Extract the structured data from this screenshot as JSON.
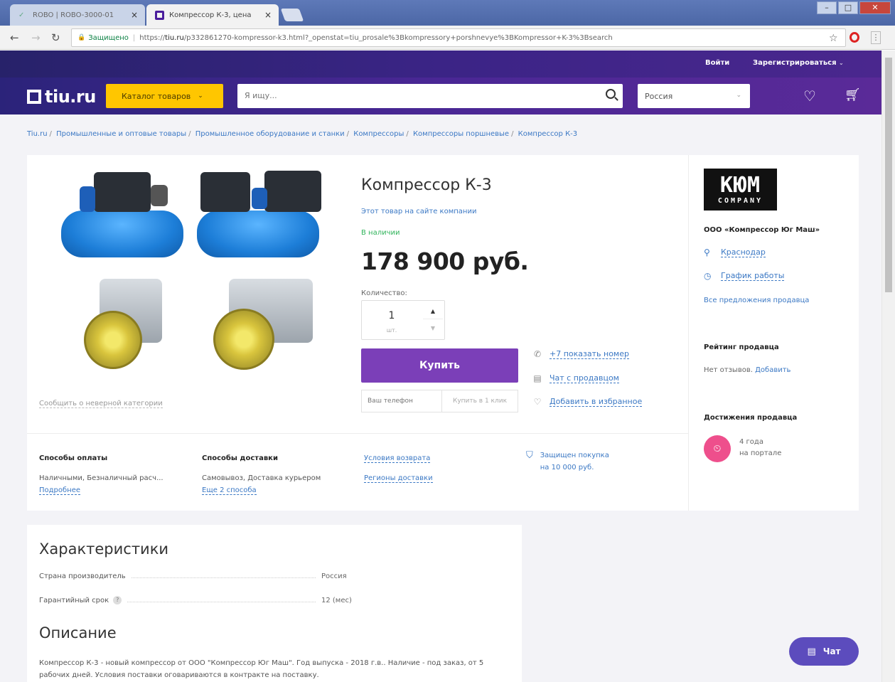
{
  "browser": {
    "tabs": [
      {
        "label": "ROBO | ROBO-3000-01",
        "close": "×"
      },
      {
        "label": "Компрессор К-3, цена",
        "close": "×"
      }
    ],
    "secure_label": "Защищено",
    "url_prefix": "https://",
    "url_host": "tiu.ru",
    "url_rest": "/p332861270-kompressor-k3.html?_openstat=tiu_prosale%3Bkompressory+porshnevye%3BKompressor+K-3%3Bsearch"
  },
  "header": {
    "login": "Войти",
    "register": "Зарегистрироваться",
    "logo": "tiu.ru",
    "catalog": "Каталог товаров",
    "search_placeholder": "Я ищу...",
    "region": "Россия"
  },
  "breadcrumb": [
    "Tiu.ru",
    "Промышленные и оптовые товары",
    "Промышленное оборудование и станки",
    "Компрессоры",
    "Компрессоры поршневые",
    "Компрессор К-3"
  ],
  "product": {
    "title": "Компрессор К-3",
    "company_link": "Этот товар на сайте компании",
    "stock": "В наличии",
    "price": "178 900 руб.",
    "qty_label": "Количество:",
    "qty": "1",
    "qty_unit": "шт.",
    "buy": "Купить",
    "phone_placeholder": "Ваш телефон",
    "one_click": "Купить в 1 клик",
    "show_phone": "+7 показать номер",
    "chat_seller": "Чат с продавцом",
    "add_fav": "Добавить в избранное",
    "report": "Сообщить о неверной категории"
  },
  "seller": {
    "logo_big": "КЮМ",
    "logo_small": "COMPANY",
    "name": "ООО «Компрессор Юг Маш»",
    "city": "Краснодар",
    "schedule": "График работы",
    "all_offers": "Все предложения продавца",
    "rating_title": "Рейтинг продавца",
    "no_reviews": "Нет отзывов.",
    "add_review": "Добавить",
    "achv_title": "Достижения продавца",
    "achv_line1": "4 года",
    "achv_line2": "на портале"
  },
  "info": {
    "payment_title": "Способы оплаты",
    "payment_text": "Наличными, Безналичный расч...",
    "payment_more": "Подробнее",
    "delivery_title": "Способы доставки",
    "delivery_text": "Самовывоз, Доставка курьером",
    "delivery_more": "Еще 2 способа",
    "return_link": "Условия возврата",
    "regions_link": "Регионы доставки",
    "protect_line1": "Защищен покупка",
    "protect_line2": "на 10 000 руб."
  },
  "characteristics": {
    "title": "Характеристики",
    "rows": [
      {
        "label": "Страна производитель",
        "value": "Россия"
      },
      {
        "label": "Гарантийный срок",
        "value": "12 (мес)"
      }
    ]
  },
  "description": {
    "title": "Описание",
    "text": "Компрессор К-3 - новый компрессор от ООО \"Компрессор Юг Маш\". Год выпуска - 2018 г.в.. Наличие - под заказ, от 5 рабочих дней. Условия поставки оговариваются в контракте на поставку."
  },
  "chat": {
    "label": "Чат"
  },
  "colors": {
    "brand_purple": "#7b3fb8",
    "catalog_yellow": "#ffc600",
    "link_blue": "#3b78c4",
    "stock_green": "#2fb35a",
    "achievement_pink": "#ee4f8c"
  }
}
